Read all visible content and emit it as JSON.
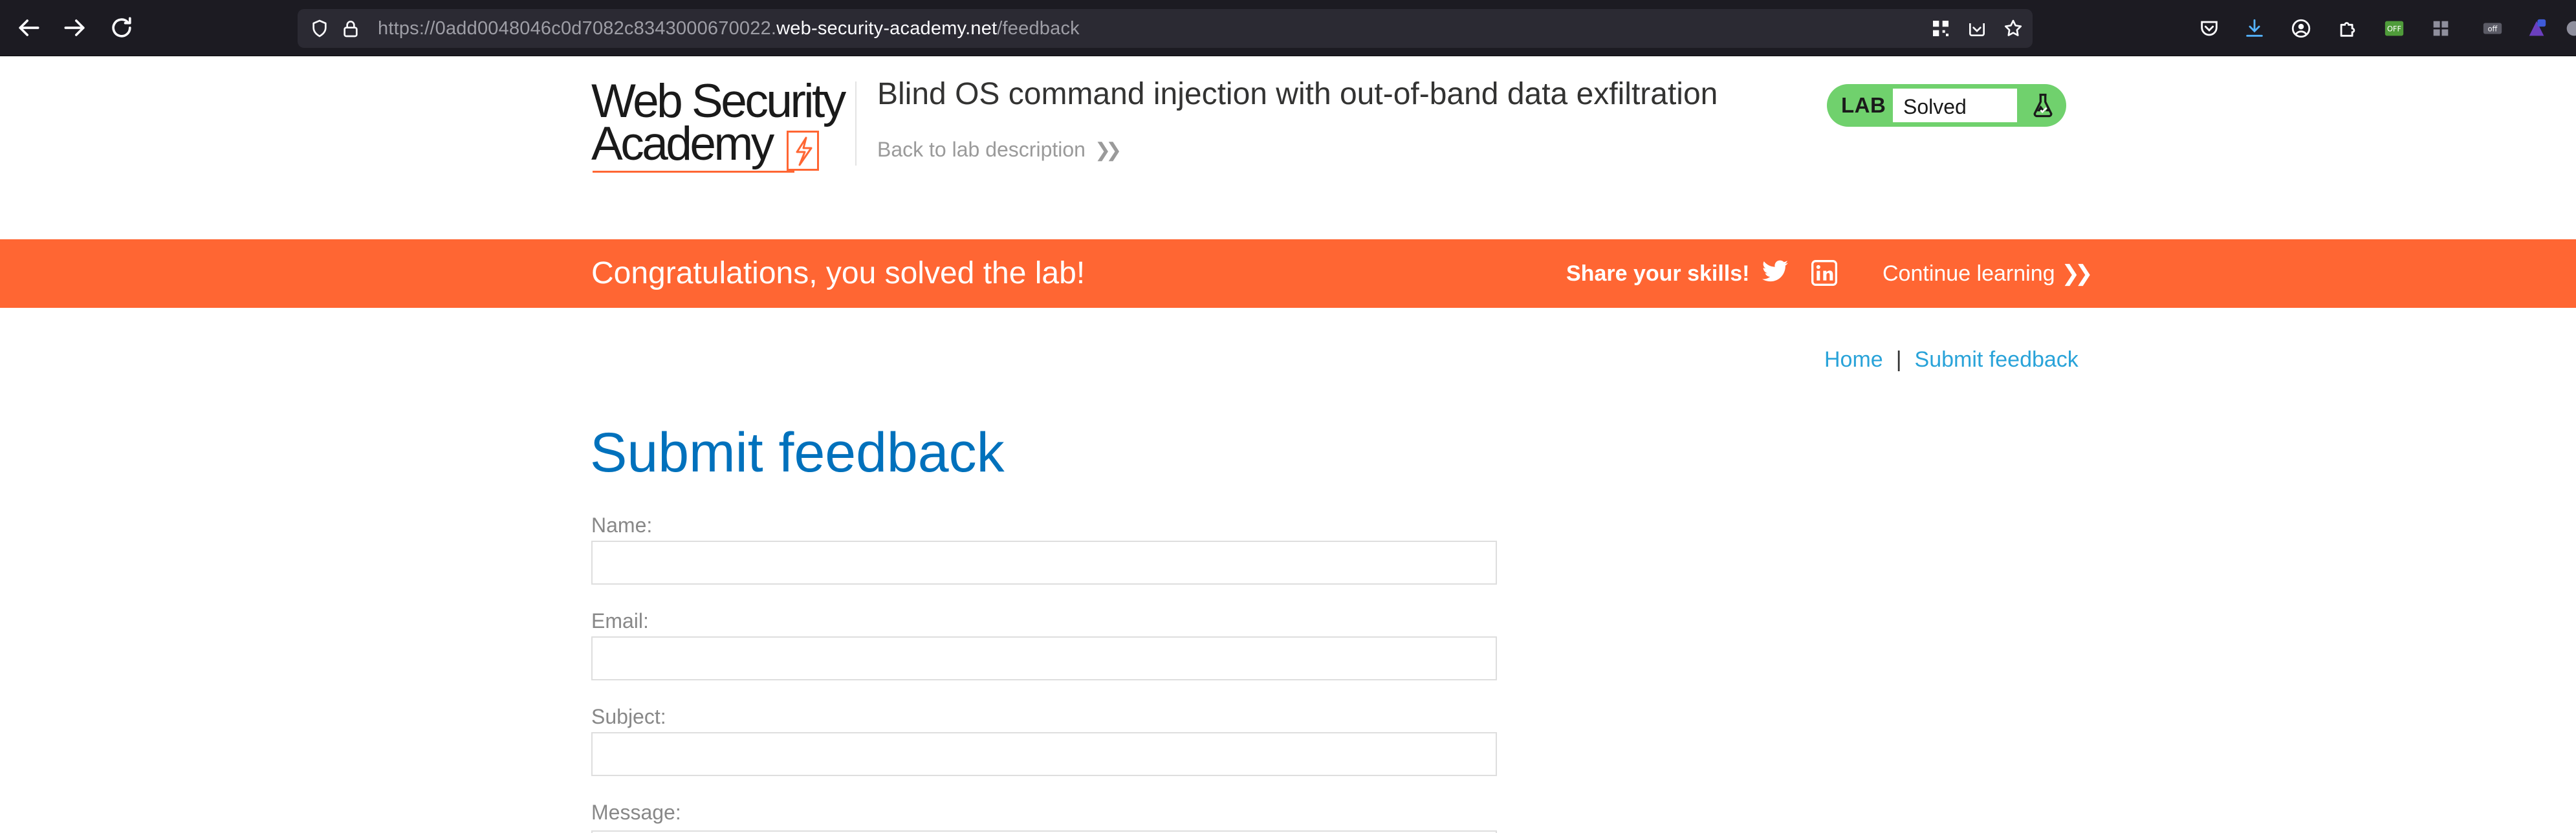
{
  "browser": {
    "url_prefix": "https://0add0048046c0d7082c8343000670022.",
    "url_domain": "web-security-academy.net",
    "url_path": "/feedback"
  },
  "header": {
    "logo_line1": "Web Security",
    "logo_line2": "Academy",
    "lab_title": "Blind OS command injection with out-of-band data exfiltration",
    "back_link": "Back to lab description",
    "lab_badge_label": "LAB",
    "lab_status": "Solved"
  },
  "banner": {
    "message": "Congratulations, you solved the lab!",
    "share_label": "Share your skills!",
    "continue_label": "Continue learning"
  },
  "breadcrumb": {
    "home": "Home",
    "separator": "|",
    "current": "Submit feedback"
  },
  "form": {
    "heading": "Submit feedback",
    "name_label": "Name:",
    "email_label": "Email:",
    "subject_label": "Subject:",
    "message_label": "Message:",
    "name_value": "",
    "email_value": "",
    "subject_value": ""
  },
  "colors": {
    "accent_orange": "#ff6633",
    "solved_green": "#70d16d",
    "heading_blue": "#0071bc",
    "link_blue": "#29a3d9"
  }
}
